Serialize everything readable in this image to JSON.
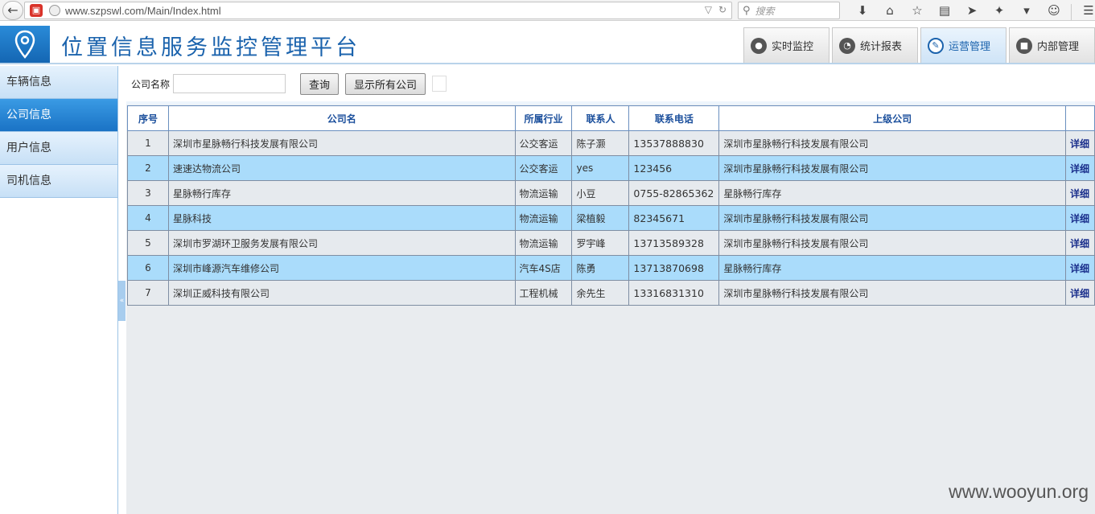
{
  "browser": {
    "url": "www.szpswl.com/Main/Index.html",
    "search_placeholder": "搜索"
  },
  "app": {
    "title": "位置信息服务监控管理平台"
  },
  "main_tabs": [
    {
      "label": "实时监控",
      "active": false
    },
    {
      "label": "统计报表",
      "active": false
    },
    {
      "label": "运营管理",
      "active": true
    },
    {
      "label": "内部管理",
      "active": false
    }
  ],
  "sidebar": {
    "items": [
      {
        "label": "车辆信息",
        "active": false
      },
      {
        "label": "公司信息",
        "active": true
      },
      {
        "label": "用户信息",
        "active": false
      },
      {
        "label": "司机信息",
        "active": false
      }
    ]
  },
  "filter": {
    "label": "公司名称",
    "value": "",
    "query_button": "查询",
    "show_all_button": "显示所有公司"
  },
  "table": {
    "columns": [
      "序号",
      "公司名",
      "所属行业",
      "联系人",
      "联系电话",
      "上级公司",
      ""
    ],
    "rows": [
      {
        "no": "1",
        "name": "深圳市星脉畅行科技发展有限公司",
        "industry": "公交客运",
        "contact": "陈子灏",
        "phone": "13537888830",
        "parent": "深圳市星脉畅行科技发展有限公司",
        "action": "详细"
      },
      {
        "no": "2",
        "name": "速速达物流公司",
        "industry": "公交客运",
        "contact": "yes",
        "phone": "123456",
        "parent": "深圳市星脉畅行科技发展有限公司",
        "action": "详细"
      },
      {
        "no": "3",
        "name": "星脉畅行库存",
        "industry": "物流运输",
        "contact": "小豆",
        "phone": "0755-82865362",
        "parent": "星脉畅行库存",
        "action": "详细"
      },
      {
        "no": "4",
        "name": "星脉科技",
        "industry": "物流运输",
        "contact": "梁植毅",
        "phone": "82345671",
        "parent": "深圳市星脉畅行科技发展有限公司",
        "action": "详细"
      },
      {
        "no": "5",
        "name": "深圳市罗湖环卫服务发展有限公司",
        "industry": "物流运输",
        "contact": "罗宇峰",
        "phone": "13713589328",
        "parent": "深圳市星脉畅行科技发展有限公司",
        "action": "详细"
      },
      {
        "no": "6",
        "name": "深圳市峰源汽车维修公司",
        "industry": "汽车4S店",
        "contact": "陈勇",
        "phone": "13713870698",
        "parent": "星脉畅行库存",
        "action": "详细"
      },
      {
        "no": "7",
        "name": "深圳正威科技有限公司",
        "industry": "工程机械",
        "contact": "余先生",
        "phone": "13316831310",
        "parent": "深圳市星脉畅行科技发展有限公司",
        "action": "详细"
      }
    ]
  },
  "watermark": "www.wooyun.org"
}
